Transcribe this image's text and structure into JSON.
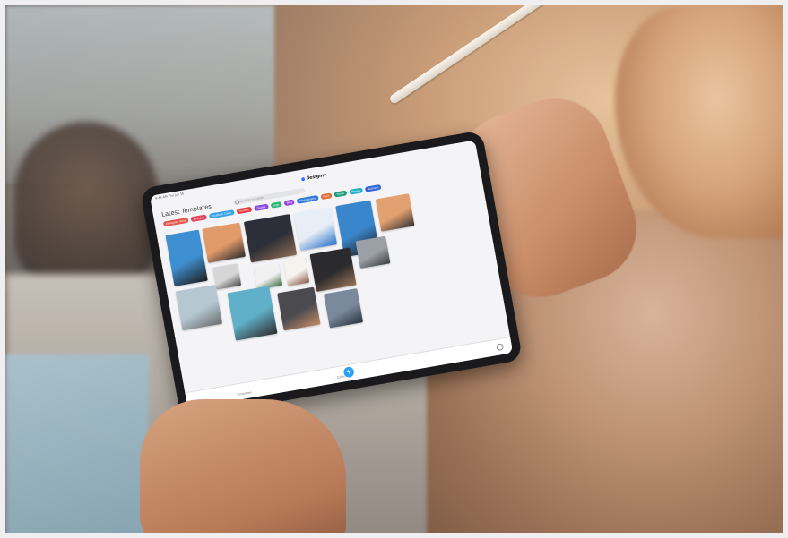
{
  "photo": {
    "subject": "Person holding a tablet and stylus",
    "background_colors": [
      "#5f5550",
      "#c99c77",
      "#efeff1"
    ]
  },
  "app": {
    "status_time": "9:41 AM  Thu Jun 16",
    "logo_text": "designrr",
    "page_title": "Latest Templates",
    "search_placeholder": "Search for templates",
    "tags": [
      {
        "label": "Instagram Story",
        "color": "#e2574c"
      },
      {
        "label": "Birthday",
        "color": "#e0445b"
      },
      {
        "label": "Facebook Cover",
        "color": "#3aa3e8"
      },
      {
        "label": "YouTube",
        "color": "#e23b3b"
      },
      {
        "label": "Quotes",
        "color": "#8a4ce0"
      },
      {
        "label": "Logo",
        "color": "#2bb673"
      },
      {
        "label": "Blog",
        "color": "#9b3fe0"
      },
      {
        "label": "Photography",
        "color": "#2f7bd6"
      },
      {
        "label": "Food",
        "color": "#e46a3a"
      },
      {
        "label": "Travel",
        "color": "#1f9e7a"
      },
      {
        "label": "Fitness",
        "color": "#27b0c9"
      },
      {
        "label": "Business",
        "color": "#3463d6"
      }
    ],
    "cards": [
      {
        "name": "palm-blue",
        "color": "#3e8fd1",
        "accent": "#1f1f1f"
      },
      {
        "name": "portrait-orange",
        "color": "#e19a6a",
        "accent": "#2e2e2e"
      },
      {
        "name": "collage",
        "color": "#2d2f38",
        "accent": "#8c6b52"
      },
      {
        "name": "recipe-card",
        "color": "#e8eef6",
        "accent": "#2a72c9"
      },
      {
        "name": "palm-blue-2",
        "color": "#3a86cc",
        "accent": "#1b1b1b"
      },
      {
        "name": "portrait-orange-2",
        "color": "#e3a070",
        "accent": "#333"
      },
      {
        "name": "portrait-small",
        "color": "#d6d6d6",
        "accent": "#4b4b4b"
      },
      {
        "name": "leaf",
        "color": "#f1f1f1",
        "accent": "#3b6d45"
      },
      {
        "name": "polaroid",
        "color": "#f6f2ee",
        "accent": "#8c5b49"
      },
      {
        "name": "street-photo",
        "color": "#2b2b2e",
        "accent": "#9a7354"
      },
      {
        "name": "pier",
        "color": "#9aa0a6",
        "accent": "#3d3f42"
      },
      {
        "name": "beach",
        "color": "#b6c7d2",
        "accent": "#6a6d70"
      },
      {
        "name": "pool",
        "color": "#5fb0c8",
        "accent": "#2d2d2d"
      },
      {
        "name": "collage-2",
        "color": "#4a4a4f",
        "accent": "#c28a64"
      },
      {
        "name": "city",
        "color": "#7a8a9c",
        "accent": "#2b3440"
      }
    ],
    "nav": {
      "left": "Templates",
      "middle": "Collections"
    },
    "fab_symbol": "+"
  }
}
